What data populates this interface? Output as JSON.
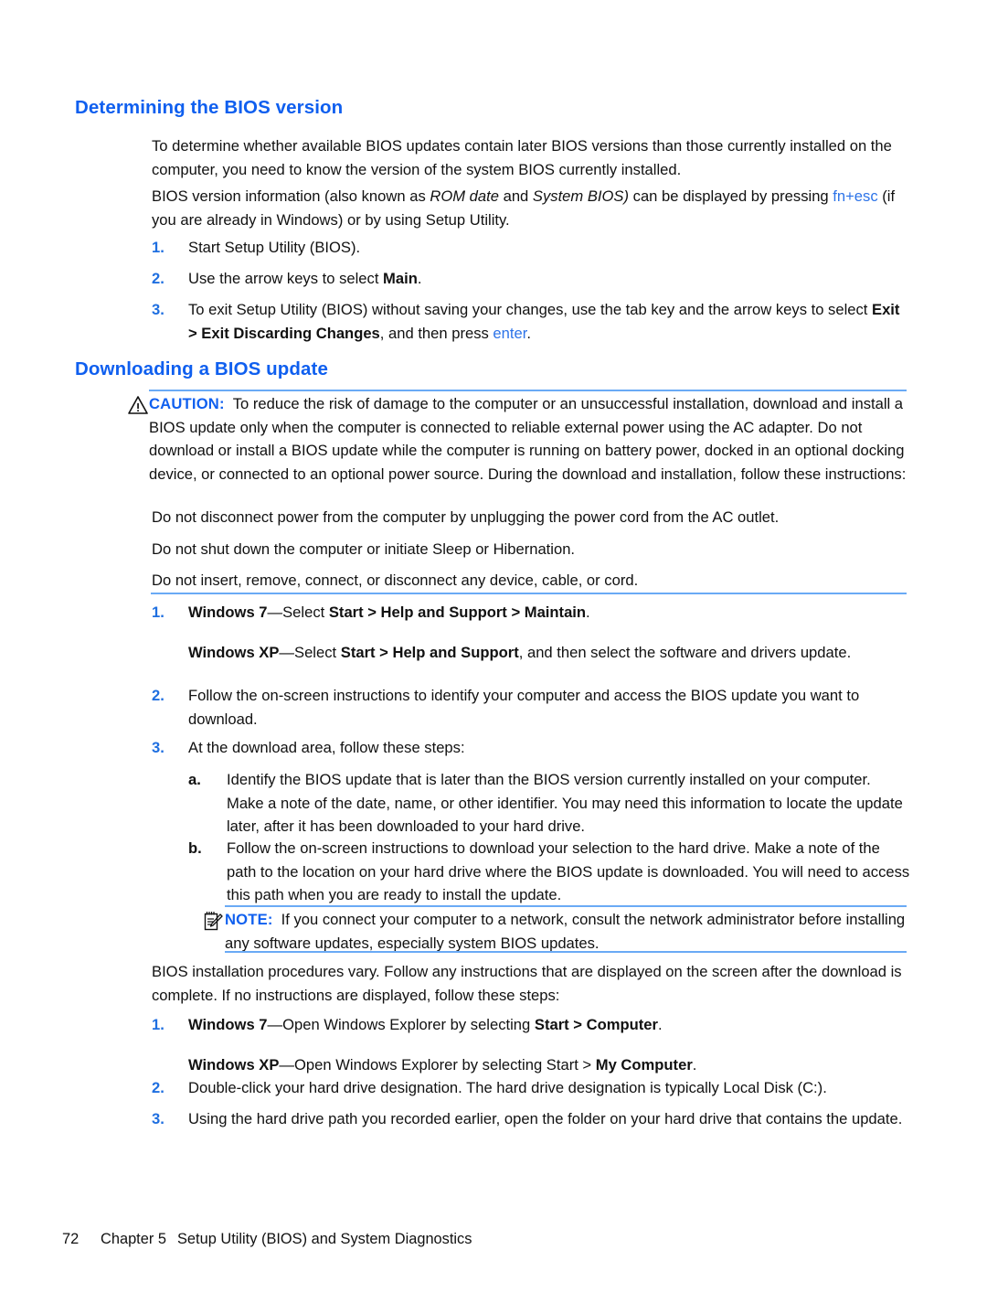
{
  "document": {
    "section1": {
      "heading": "Determining the BIOS version",
      "para1": "To determine whether available BIOS updates contain later BIOS versions than those currently installed on the computer, you need to know the version of the system BIOS currently installed.",
      "para2_a": "BIOS version information (also known as ",
      "para2_i1": "ROM date",
      "para2_b": " and ",
      "para2_i2": "System BIOS)",
      "para2_c": " can be displayed by pressing ",
      "para2_link": "fn+esc",
      "para2_d": " (if you are already in Windows) or by using Setup Utility.",
      "steps": [
        {
          "num": "1.",
          "text": "Start Setup Utility (BIOS)."
        },
        {
          "num": "2.",
          "pre": "Use the arrow keys to select ",
          "bold": "Main",
          "post": "."
        },
        {
          "num": "3.",
          "pre": "To exit Setup Utility (BIOS) without saving your changes, use the tab key and the arrow keys to select ",
          "bold": "Exit > Exit Discarding Changes",
          "mid": ", and then press ",
          "link": "enter",
          "post": "."
        }
      ]
    },
    "section2": {
      "heading": "Downloading a BIOS update",
      "caution": {
        "icon": "warning-triangle-icon",
        "label": "CAUTION:",
        "text": "To reduce the risk of damage to the computer or an unsuccessful installation, download and install a BIOS update only when the computer is connected to reliable external power using the AC adapter. Do not download or install a BIOS update while the computer is running on battery power, docked in an optional docking device, or connected to an optional power source. During the download and installation, follow these instructions:"
      },
      "bullets": [
        "Do not disconnect power from the computer by unplugging the power cord from the AC outlet.",
        "Do not shut down the computer or initiate Sleep or Hibernation.",
        "Do not insert, remove, connect, or disconnect any device, cable, or cord."
      ],
      "steps": [
        {
          "num": "1.",
          "b1": "Windows 7",
          "t1": "—Select ",
          "b2": "Start > Help and Support > Maintain",
          "t2": ".",
          "sub_b1": "Windows XP",
          "sub_t1": "—Select ",
          "sub_b2": "Start > Help and Support",
          "sub_t2": ", and then select the software and drivers update."
        },
        {
          "num": "2.",
          "text": "Follow the on-screen instructions to identify your computer and access the BIOS update you want to download."
        },
        {
          "num": "3.",
          "text": "At the download area, follow these steps:"
        }
      ],
      "substeps": [
        {
          "letter": "a.",
          "text": "Identify the BIOS update that is later than the BIOS version currently installed on your computer. Make a note of the date, name, or other identifier. You may need this information to locate the update later, after it has been downloaded to your hard drive."
        },
        {
          "letter": "b.",
          "text": "Follow the on-screen instructions to download your selection to the hard drive. Make a note of the path to the location on your hard drive where the BIOS update is downloaded. You will need to access this path when you are ready to install the update."
        }
      ],
      "note": {
        "icon": "notepad-pencil-icon",
        "label": "NOTE:",
        "text": "If you connect your computer to a network, consult the network administrator before installing any software updates, especially system BIOS updates."
      },
      "closing_para": "BIOS installation procedures vary. Follow any instructions that are displayed on the screen after the download is complete. If no instructions are displayed, follow these steps:",
      "final_steps": [
        {
          "num": "1.",
          "b1": "Windows 7",
          "t1": "—Open Windows Explorer by selecting ",
          "b2": "Start > Computer",
          "t2": ".",
          "sub_b1": "Windows XP",
          "sub_t1": "—Open Windows Explorer by selecting Start > ",
          "sub_b2": "My Computer",
          "sub_t2": "."
        },
        {
          "num": "2.",
          "text": "Double-click your hard drive designation. The hard drive designation is typically Local Disk (C:)."
        },
        {
          "num": "3.",
          "text": "Using the hard drive path you recorded earlier, open the folder on your hard drive that contains the update."
        }
      ]
    }
  },
  "footer": {
    "page_number": "72",
    "chapter": "Chapter 5",
    "title": "Setup Utility (BIOS) and System Diagnostics"
  },
  "colors": {
    "heading_blue": "#0f5fef",
    "label_blue": "#1060ef",
    "rule_blue": "#6aaaf5",
    "link_blue": "#2c73e8",
    "marker_blue": "#1f6fe0"
  }
}
